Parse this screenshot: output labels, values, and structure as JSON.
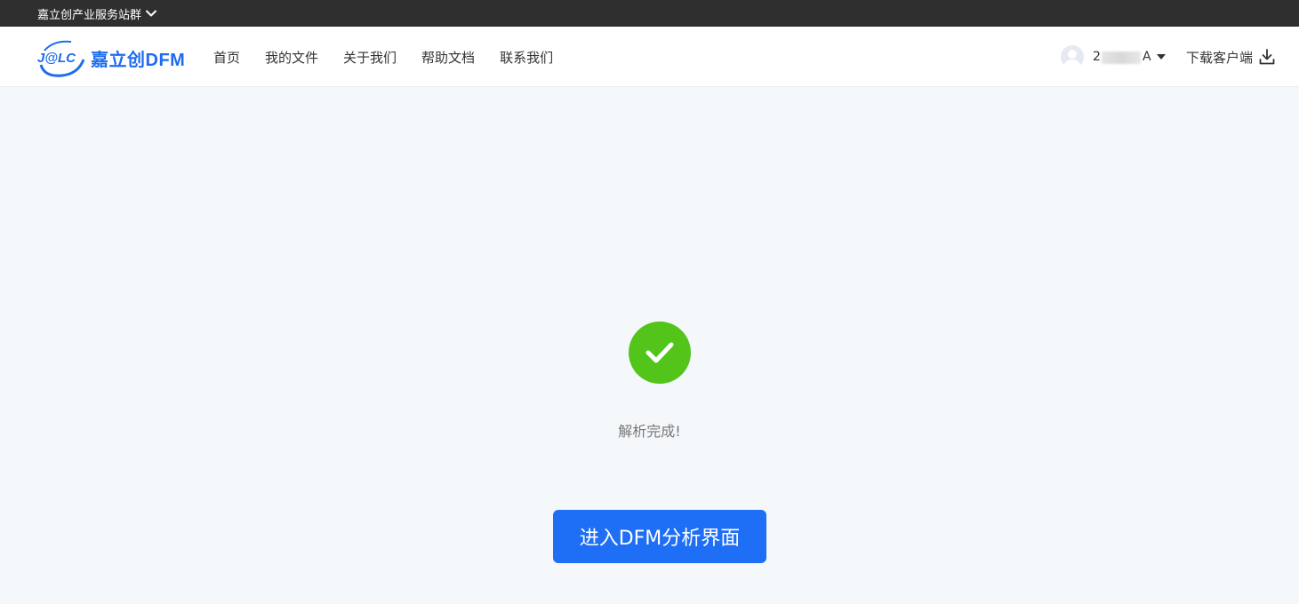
{
  "topbar": {
    "group_label": "嘉立创产业服务站群",
    "group_icon": "chevron-down-icon"
  },
  "header": {
    "logo_mark": "J@LC",
    "logo_text": "嘉立创DFM",
    "nav": [
      {
        "label": "首页"
      },
      {
        "label": "我的文件"
      },
      {
        "label": "关于我们"
      },
      {
        "label": "帮助文档"
      },
      {
        "label": "联系我们"
      }
    ],
    "user": {
      "name_visible_start": "2",
      "name_visible_end": "A",
      "avatar_icon": "user-avatar-icon",
      "caret_icon": "caret-down-icon"
    },
    "download": {
      "label": "下载客户端",
      "icon": "download-icon"
    }
  },
  "main": {
    "status_icon": "check-circle-icon",
    "status_text": "解析完成!",
    "enter_button": "进入DFM分析界面"
  },
  "colors": {
    "brand_blue": "#1e6cf0",
    "success_green": "#52c41a",
    "topbar_bg": "#2f2f2f",
    "page_bg": "#f5f8fb"
  }
}
